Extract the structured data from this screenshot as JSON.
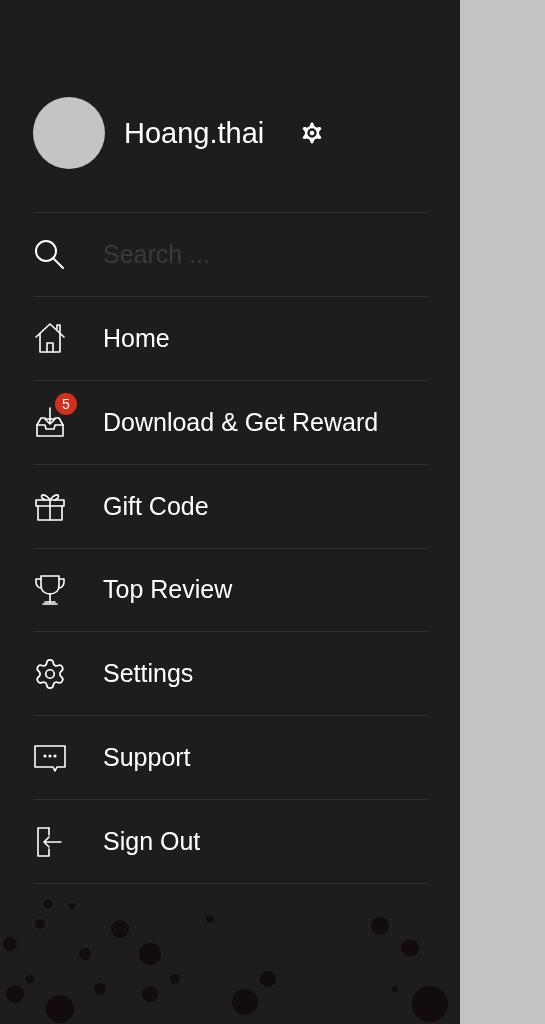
{
  "profile": {
    "username": "Hoang.thai"
  },
  "search": {
    "placeholder": "Search ..."
  },
  "menu": [
    {
      "label": "Home"
    },
    {
      "label": "Download & Get Reward",
      "badge": "5"
    },
    {
      "label": "Gift Code"
    },
    {
      "label": "Top Review"
    },
    {
      "label": "Settings"
    },
    {
      "label": "Support"
    },
    {
      "label": "Sign Out"
    }
  ]
}
